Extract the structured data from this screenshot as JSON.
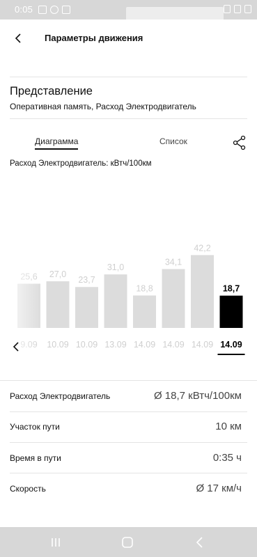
{
  "status_bar": {
    "time": "0:05"
  },
  "header": {
    "title": "Параметры движения"
  },
  "section": {
    "title": "Представление",
    "subtitle": "Оперативная память, Расход Электродвигатель"
  },
  "tabs": [
    {
      "label": "Диаграмма",
      "active": true
    },
    {
      "label": "Список",
      "active": false
    }
  ],
  "chart_label": "Расход Электродвигатель: кВтч/100км",
  "chart_data": {
    "type": "bar",
    "title": "Расход Электродвигатель: кВтч/100км",
    "categories": [
      "9.09",
      "10.09",
      "10.09",
      "13.09",
      "14.09",
      "14.09",
      "14.09",
      "14.09"
    ],
    "values": [
      25.6,
      27.0,
      23.7,
      31.0,
      18.8,
      34.1,
      42.2,
      18.7
    ],
    "selected_index": 7,
    "colors": {
      "bar": "#dcdcdc",
      "selected": "#000000",
      "label": "#cfcfcf",
      "selected_label": "#000000"
    }
  },
  "summary": [
    {
      "label": "Расход Электродвигатель",
      "value": "Ø 18,7 кВтч/100км"
    },
    {
      "label": "Участок пути",
      "value": "10 км"
    },
    {
      "label": "Время в пути",
      "value": "0:35 ч"
    },
    {
      "label": "Скорость",
      "value": "Ø 17 км/ч"
    }
  ]
}
